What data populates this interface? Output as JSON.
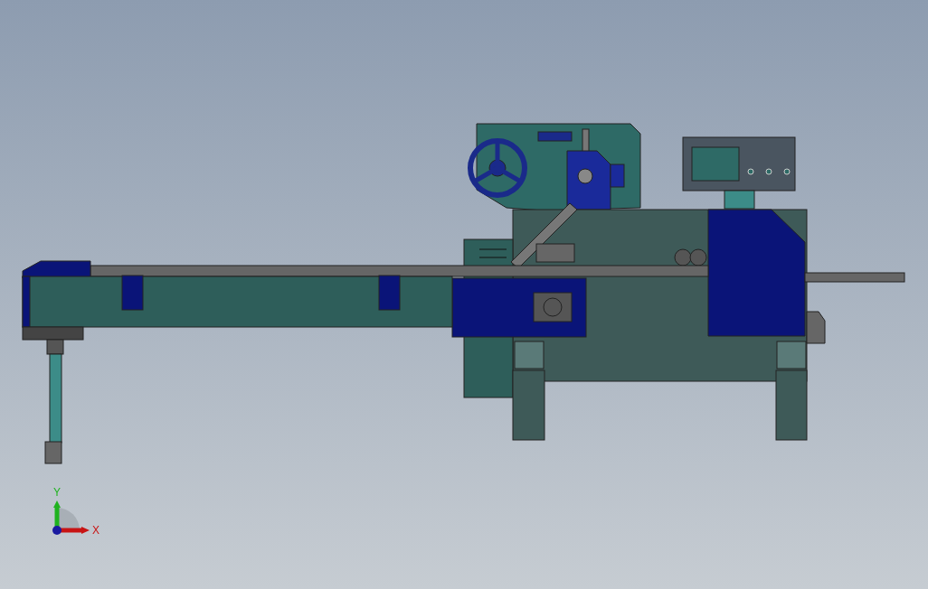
{
  "viewport": {
    "axes": [
      {
        "kind": "y",
        "label": "Y",
        "color": "#1fb21f"
      },
      {
        "kind": "x",
        "label": "X",
        "color": "#c81414"
      }
    ]
  }
}
